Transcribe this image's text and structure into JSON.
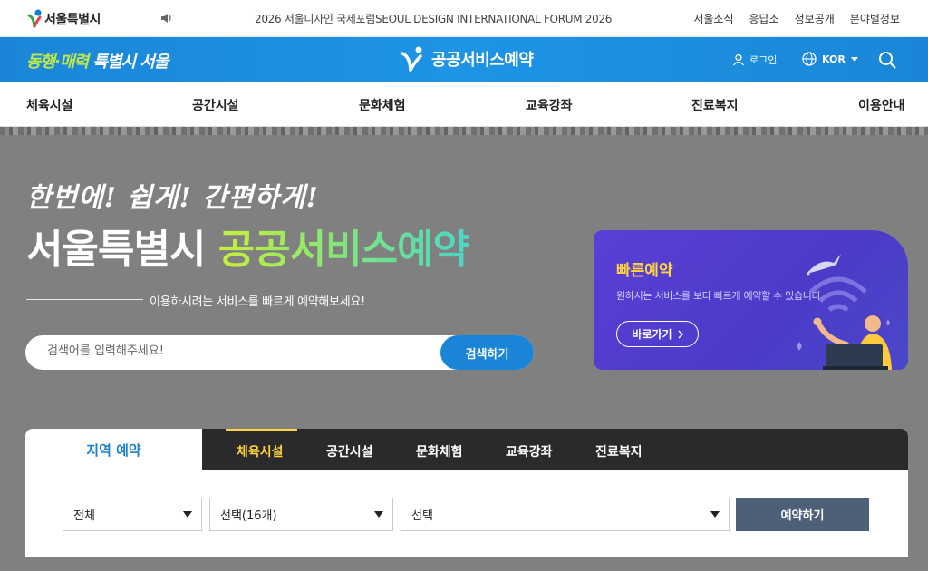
{
  "utility": {
    "logo_text": "서울특별시",
    "notice": "2026 서울디자인 국제포럼SEOUL DESIGN INTERNATIONAL FORUM 2026",
    "links": [
      "서울소식",
      "응답소",
      "정보공개",
      "분야별정보"
    ]
  },
  "brand": {
    "slogan_a": "동행·매력",
    "slogan_b": " 특별시 서울",
    "service_name": "공공서비스예약",
    "login_label": "로그인",
    "language": "KOR"
  },
  "nav": {
    "items": [
      "체육시설",
      "공간시설",
      "문화체험",
      "교육강좌",
      "진료복지",
      "이용안내"
    ]
  },
  "hero": {
    "line1": "한번에! 쉽게! 간편하게!",
    "line2_a": "서울특별시 ",
    "line2_b": "공공서비스예약",
    "subtitle": "이용하시려는 서비스를 빠르게 예약해보세요!",
    "search_placeholder": "검색어를 입력해주세요!",
    "search_button": "검색하기"
  },
  "quick": {
    "title": "빠른예약",
    "description": "원하시는 서비스를 보다 빠르게 예약할 수 있습니다.",
    "button": "바로가기"
  },
  "reservation": {
    "region_tab": "지역 예약",
    "categories": [
      "체육시설",
      "공간시설",
      "문화체험",
      "교육강좌",
      "진료복지"
    ],
    "active_category": "체육시설",
    "select_region": "전체",
    "select_facility": "선택(16개)",
    "select_item": "선택",
    "book_button": "예약하기"
  },
  "colors": {
    "brand_blue": "#1b86d8",
    "accent_yellow": "#ffd33d",
    "quick_purple": "#5a3fd6",
    "book_button": "#4d6078"
  }
}
